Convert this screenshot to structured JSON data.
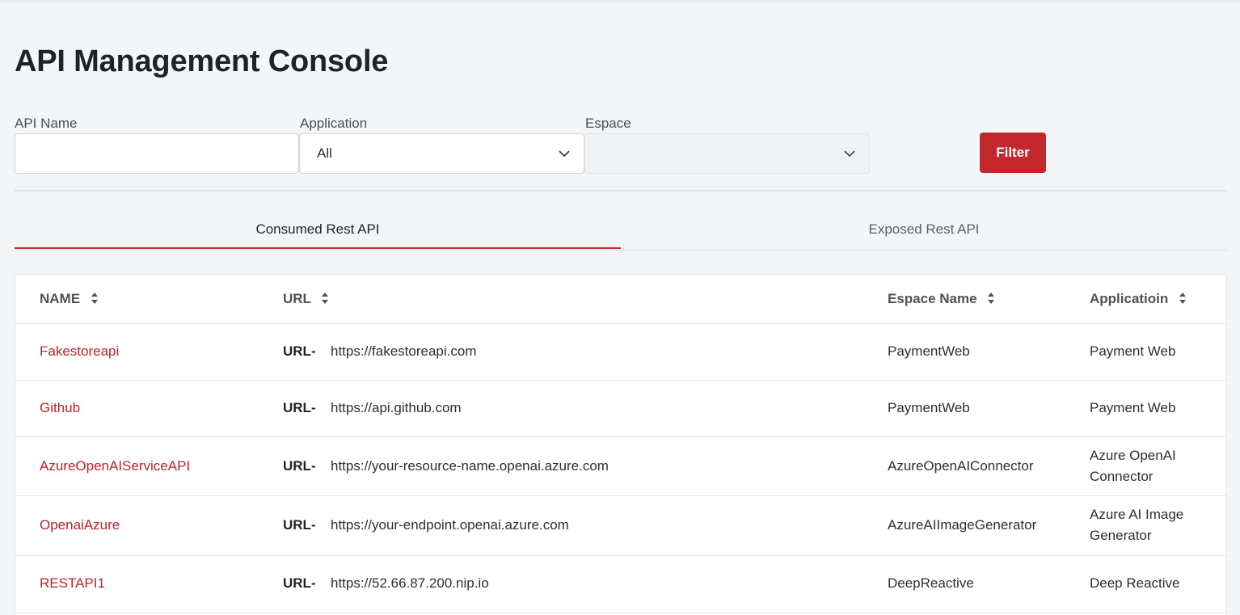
{
  "header": {
    "title": "API Management Console"
  },
  "filters": {
    "api_name_label": "API Name",
    "api_name_value": "",
    "application_label": "Application",
    "application_value": "All",
    "espace_label": "Espace",
    "espace_value": "",
    "filter_button": "Filter"
  },
  "tabs": [
    {
      "label": "Consumed Rest API",
      "active": true
    },
    {
      "label": "Exposed Rest API",
      "active": false
    }
  ],
  "table": {
    "columns": [
      "NAME",
      "URL",
      "Espace Name",
      "Applicatioin"
    ],
    "url_prefix": "URL-",
    "rows": [
      {
        "name": "Fakestoreapi",
        "url": "https://fakestoreapi.com",
        "espace": "PaymentWeb",
        "application": "Payment Web"
      },
      {
        "name": "Github",
        "url": "https://api.github.com",
        "espace": "PaymentWeb",
        "application": "Payment Web"
      },
      {
        "name": "AzureOpenAIServiceAPI",
        "url": "https://your-resource-name.openai.azure.com",
        "espace": "AzureOpenAIConnector",
        "application": "Azure OpenAI Connector"
      },
      {
        "name": "OpenaiAzure",
        "url": "https://your-endpoint.openai.azure.com",
        "espace": "AzureAIImageGenerator",
        "application": "Azure AI Image Generator"
      },
      {
        "name": "RESTAPI1",
        "url": "https://52.66.87.200.nip.io",
        "espace": "DeepReactive",
        "application": "Deep Reactive"
      }
    ]
  },
  "colors": {
    "accent": "#c2272d",
    "link": "#b5252b",
    "background": "#f4f5f7"
  },
  "icons": {
    "select_chevron": "chevron-down-icon",
    "sort": "sort-icon"
  }
}
